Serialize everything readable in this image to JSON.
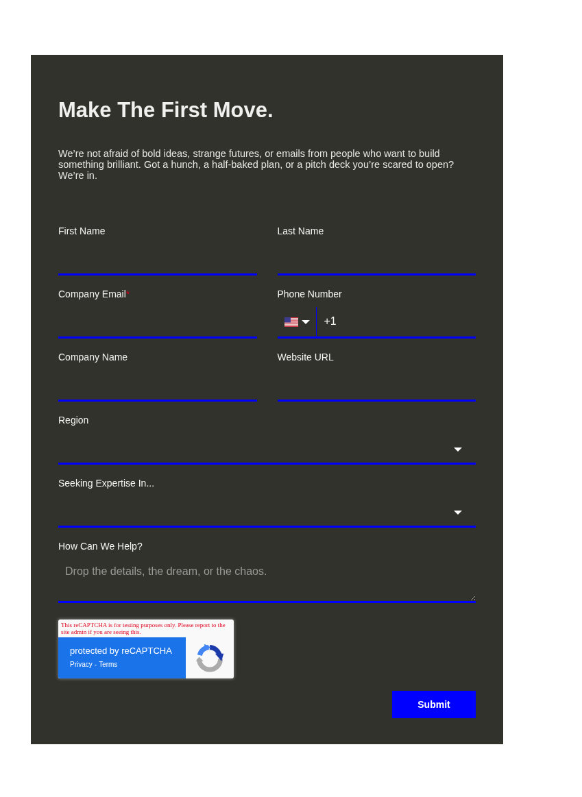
{
  "form": {
    "title": "Make The First Move.",
    "intro": "We’re not afraid of bold ideas, strange futures, or emails from people who want to build something brilliant. Got a hunch, a half-baked plan, or a pitch deck you’re scared to open? We’re in.",
    "fields": [
      {
        "kind": "text",
        "label": "First Name"
      },
      {
        "kind": "text",
        "label": "Last Name"
      },
      {
        "kind": "text",
        "label": "Company Email",
        "required_mark": "*"
      },
      {
        "kind": "phone",
        "label": "Phone Number",
        "dial_code": "+1"
      },
      {
        "kind": "text",
        "label": "Company Name"
      },
      {
        "kind": "text",
        "label": "Website URL"
      },
      {
        "kind": "select",
        "label": "Region"
      },
      {
        "kind": "select",
        "label": "Seeking Expertise In..."
      },
      {
        "kind": "textarea",
        "label": "How Can We Help?",
        "placeholder": "Drop the details, the dream, or the chaos."
      }
    ],
    "recaptcha": {
      "notice": "This reCAPTCHA is for testing purposes only. Please report to the site admin if you are seeing this.",
      "title": "protected by reCAPTCHA",
      "links": [
        "Privacy",
        "Terms"
      ],
      "separator": "-"
    },
    "submit": "Submit"
  }
}
